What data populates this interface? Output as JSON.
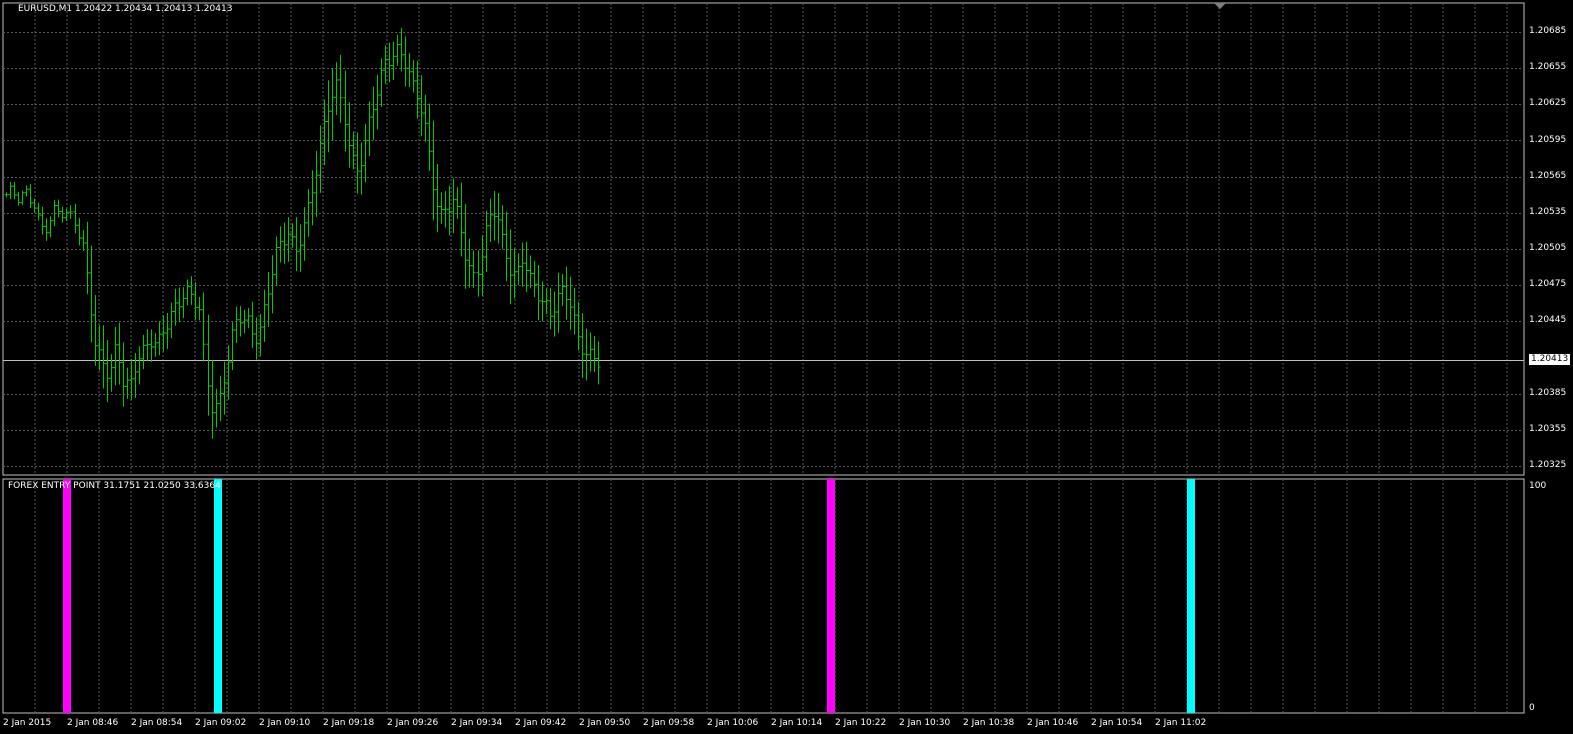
{
  "header": {
    "symbol_line": "EURUSD,M1  1.20422 1.20434 1.20413 1.20413"
  },
  "indicator": {
    "title_line": "FOREX ENTRY POINT 31.1751 21.0250 33.6364",
    "y_max_label": "100",
    "y_min_label": "0"
  },
  "colors": {
    "background": "#000000",
    "grid": "#5a5a5a",
    "bars": "#00cc00",
    "buy_signal": "#00ffff",
    "sell_signal": "#ff00ff",
    "text": "#ffffff"
  },
  "chart_data": [
    {
      "type": "ohlc",
      "symbol": "EURUSD",
      "timeframe": "M1",
      "ylim": [
        1.20325,
        1.207
      ],
      "price_ticks": [
        "1.20685",
        "1.20655",
        "1.20625",
        "1.20595",
        "1.20565",
        "1.20535",
        "1.20505",
        "1.20475",
        "1.20445",
        "1.20413",
        "1.20385",
        "1.20355",
        "1.20325"
      ],
      "current_price": "1.20413",
      "time_ticks": [
        "2 Jan 2015",
        "2 Jan 08:46",
        "2 Jan 08:54",
        "2 Jan 09:02",
        "2 Jan 09:10",
        "2 Jan 09:18",
        "2 Jan 09:26",
        "2 Jan 09:34",
        "2 Jan 09:42",
        "2 Jan 09:50",
        "2 Jan 09:58",
        "2 Jan 10:06",
        "2 Jan 10:14",
        "2 Jan 10:22",
        "2 Jan 10:30",
        "2 Jan 10:38",
        "2 Jan 10:46",
        "2 Jan 10:54",
        "2 Jan 11:02"
      ],
      "close_path": [
        1.2055,
        1.20552,
        1.20548,
        1.2055,
        1.20545,
        1.2052,
        1.20525,
        1.20535,
        1.20538,
        1.20532,
        1.20528,
        1.2051,
        1.2047,
        1.2042,
        1.2041,
        1.204,
        1.20425,
        1.20395,
        1.2039,
        1.20415,
        1.2042,
        1.2043,
        1.20425,
        1.2044,
        1.2045,
        1.2046,
        1.2047,
        1.20465,
        1.2046,
        1.204,
        1.2037,
        1.2038,
        1.2041,
        1.2044,
        1.2045,
        1.20445,
        1.2043,
        1.2044,
        1.2047,
        1.205,
        1.2051,
        1.2052,
        1.205,
        1.2052,
        1.2054,
        1.2057,
        1.206,
        1.2063,
        1.2064,
        1.2062,
        1.2058,
        1.2057,
        1.2059,
        1.2062,
        1.2064,
        1.2066,
        1.20665,
        1.2067,
        1.2066,
        1.2064,
        1.2063,
        1.206,
        1.2056,
        1.2053,
        1.2054,
        1.20545,
        1.20525,
        1.2049,
        1.2048,
        1.205,
        1.2053,
        1.2054,
        1.2051,
        1.2049,
        1.2048,
        1.205,
        1.2048,
        1.2047,
        1.2046,
        1.2045,
        1.20465,
        1.2047,
        1.2046,
        1.2043,
        1.2042,
        1.20415,
        1.20413
      ],
      "range_path": [
        0.00012,
        0.0001,
        8e-05,
        9e-05,
        0.00014,
        0.00018,
        0.0002,
        0.00015,
        0.00012,
        0.00016,
        0.00018,
        0.00025,
        0.0006,
        0.0007,
        0.00055,
        0.0006,
        0.00045,
        0.00055,
        0.0005,
        0.0004,
        0.00035,
        0.00035,
        0.00035,
        0.0004,
        0.0004,
        0.00035,
        0.0003,
        0.00025,
        0.0003,
        0.0007,
        0.0006,
        0.0005,
        0.00045,
        0.00035,
        0.0003,
        0.0003,
        0.00035,
        0.00045,
        0.0005,
        0.00045,
        0.0004,
        0.00045,
        0.0005,
        0.00045,
        0.0005,
        0.00055,
        0.00065,
        0.0007,
        0.00075,
        0.0006,
        0.0006,
        0.00055,
        0.0005,
        0.00055,
        0.00045,
        0.0004,
        0.00035,
        0.00045,
        0.0004,
        0.00045,
        0.0005,
        0.0006,
        0.0007,
        0.00055,
        0.0005,
        0.00055,
        0.0006,
        0.00065,
        0.00055,
        0.0005,
        0.0005,
        0.00055,
        0.0006,
        0.00065,
        0.0006,
        0.0005,
        0.00045,
        0.00045,
        0.00045,
        0.0004,
        0.0005,
        0.00055,
        0.0005,
        0.00055,
        0.0006,
        0.0005,
        0.0004
      ]
    },
    {
      "type": "bar",
      "title": "FOREX ENTRY POINT",
      "values_shown": [
        31.1751,
        21.025,
        33.6364
      ],
      "ylim": [
        0,
        100
      ],
      "signals": [
        {
          "time": "2 Jan 08:45",
          "kind": "sell",
          "value": 100
        },
        {
          "time": "2 Jan 09:03",
          "kind": "buy",
          "value": 100
        },
        {
          "time": "2 Jan 10:20",
          "kind": "sell",
          "value": 100
        },
        {
          "time": "2 Jan 11:05",
          "kind": "buy",
          "value": 100
        }
      ]
    }
  ]
}
